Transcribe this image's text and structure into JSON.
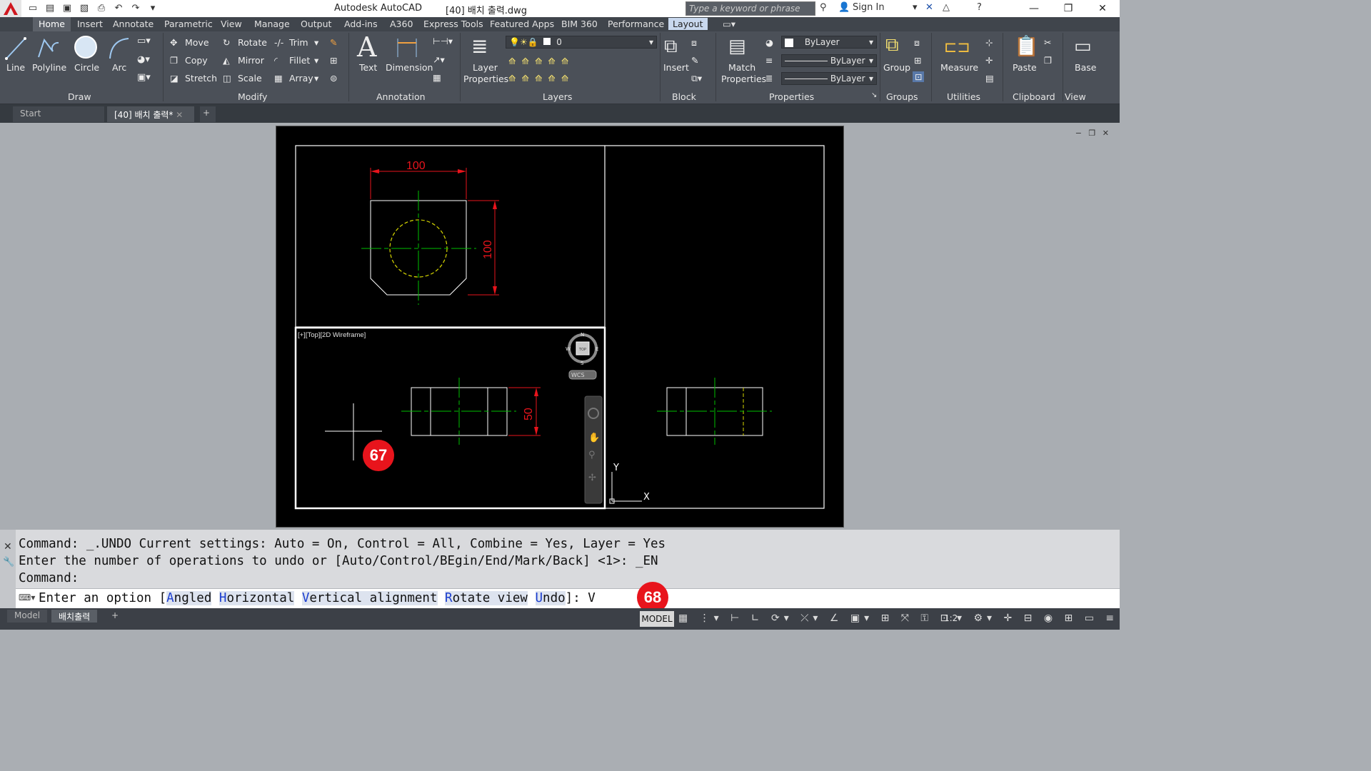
{
  "titlebar": {
    "app_name": "Autodesk AutoCAD",
    "file_name": "[40] 배치 출력.dwg",
    "search_placeholder": "Type a keyword or phrase",
    "sign_in": "Sign In"
  },
  "ribbon_tabs": [
    "Home",
    "Insert",
    "Annotate",
    "Parametric",
    "View",
    "Manage",
    "Output",
    "Add-ins",
    "A360",
    "Express Tools",
    "Featured Apps",
    "BIM 360",
    "Performance",
    "Layout"
  ],
  "ribbon": {
    "draw": {
      "title": "Draw",
      "line": "Line",
      "polyline": "Polyline",
      "circle": "Circle",
      "arc": "Arc"
    },
    "modify": {
      "title": "Modify",
      "move": "Move",
      "rotate": "Rotate",
      "trim": "Trim",
      "copy": "Copy",
      "mirror": "Mirror",
      "fillet": "Fillet",
      "stretch": "Stretch",
      "scale": "Scale",
      "array": "Array"
    },
    "annotation": {
      "title": "Annotation",
      "text": "Text",
      "dimension": "Dimension"
    },
    "layers": {
      "title": "Layers",
      "layer_properties": "Layer Properties",
      "current_layer": "0"
    },
    "block": {
      "title": "Block",
      "insert": "Insert"
    },
    "properties": {
      "title": "Properties",
      "match_properties": "Match Properties",
      "color": "ByLayer",
      "linetype": "ByLayer",
      "lineweight": "ByLayer"
    },
    "groups": {
      "title": "Groups",
      "group": "Group"
    },
    "utilities": {
      "title": "Utilities",
      "measure": "Measure"
    },
    "clipboard": {
      "title": "Clipboard",
      "paste": "Paste"
    },
    "view": {
      "title": "View",
      "base": "Base"
    }
  },
  "doc_tabs": {
    "start": "Start",
    "active": "[40] 배치 출력*"
  },
  "drawing": {
    "viewport_label": "[+][Top][2D Wireframe]",
    "dim_top_width": "100",
    "dim_top_height": "100",
    "dim_bottom_height": "50",
    "compass": {
      "n": "N",
      "s": "S",
      "e": "E",
      "w": "W",
      "top": "TOP",
      "wcs": "WCS"
    },
    "ucs": {
      "x": "X",
      "y": "Y"
    }
  },
  "command": {
    "history_1": "Command: _.UNDO Current settings: Auto = On, Control = All, Combine = Yes, Layer = Yes",
    "history_2": "Enter the number of operations to undo or [Auto/Control/BEgin/End/Mark/Back] <1>: _EN",
    "history_3": "Command:",
    "prompt_prefix": "Enter an option [",
    "options": [
      {
        "hotkey": "A",
        "rest": "ngled"
      },
      {
        "hotkey": "H",
        "rest": "orizontal"
      },
      {
        "hotkey": "V",
        "rest": "ertical alignment"
      },
      {
        "hotkey": "R",
        "rest": "otate view"
      },
      {
        "hotkey": "U",
        "rest": "ndo"
      }
    ],
    "prompt_suffix": "]: V"
  },
  "statusbar": {
    "model_tab": "Model",
    "layout_tab": "배치출력",
    "model_button": "MODEL",
    "scale": "1:2"
  },
  "badges": {
    "step_1": "67",
    "step_2": "68"
  },
  "colors": {
    "ribbon": "#4b5058",
    "paper": "#000000",
    "dimension": "#e8141c",
    "centerline": "#00c000",
    "hidden": "#d8d800",
    "badge": "#e8141c"
  }
}
